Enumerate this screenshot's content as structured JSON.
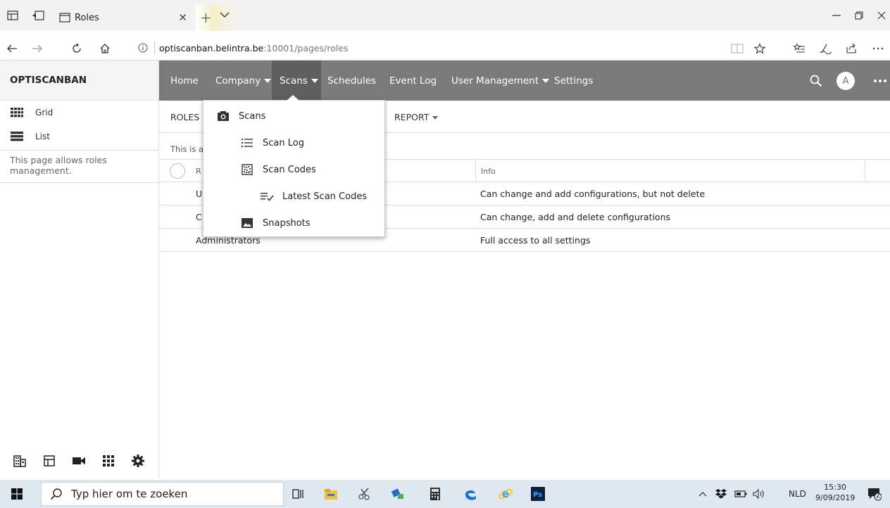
{
  "browser": {
    "tab_title": "Roles",
    "url_host": "optiscanban.belintra.be",
    "url_path": ":10001/pages/roles"
  },
  "app": {
    "brand": "OPTISCANBAN",
    "nav": [
      {
        "label": "Home",
        "caret": false
      },
      {
        "label": "Company",
        "caret": true
      },
      {
        "label": "Scans",
        "caret": true
      },
      {
        "label": "Schedules",
        "caret": false
      },
      {
        "label": "Event Log",
        "caret": false
      },
      {
        "label": "User Management",
        "caret": true
      },
      {
        "label": "Settings",
        "caret": false
      }
    ],
    "avatar_initial": "A"
  },
  "sidebar": {
    "items": [
      {
        "label": "Grid",
        "icon": "grid-icon"
      },
      {
        "label": "List",
        "icon": "list-icon"
      }
    ],
    "description": "This page allows roles management."
  },
  "toolbar": {
    "roles_label": "ROLES (",
    "report_label": "REPORT"
  },
  "content": {
    "description": "This is a",
    "columns": [
      "R",
      "Info"
    ],
    "rows": [
      {
        "name": "U",
        "info": "Can change and add configurations, but not delete"
      },
      {
        "name": "C",
        "info": "Can change, add and delete configurations"
      },
      {
        "name": "Administrators",
        "info": "Full access to all settings"
      }
    ]
  },
  "dropdown": {
    "items": [
      {
        "label": "Scans",
        "icon": "camera-icon"
      },
      {
        "label": "Scan Log",
        "icon": "list-icon"
      },
      {
        "label": "Scan Codes",
        "icon": "qr-icon"
      },
      {
        "label": "Latest Scan Codes",
        "icon": "checklist-icon"
      },
      {
        "label": "Snapshots",
        "icon": "image-icon"
      }
    ]
  },
  "taskbar": {
    "search_placeholder": "Typ hier om te zoeken",
    "language": "NLD",
    "time": "15:30",
    "date": "9/09/2019",
    "notification_count": "2"
  },
  "colors": {
    "nav_bg": "#7a7a7a",
    "nav_active": "#5f5f5f",
    "taskbar_bg": "#dfe7f1"
  }
}
